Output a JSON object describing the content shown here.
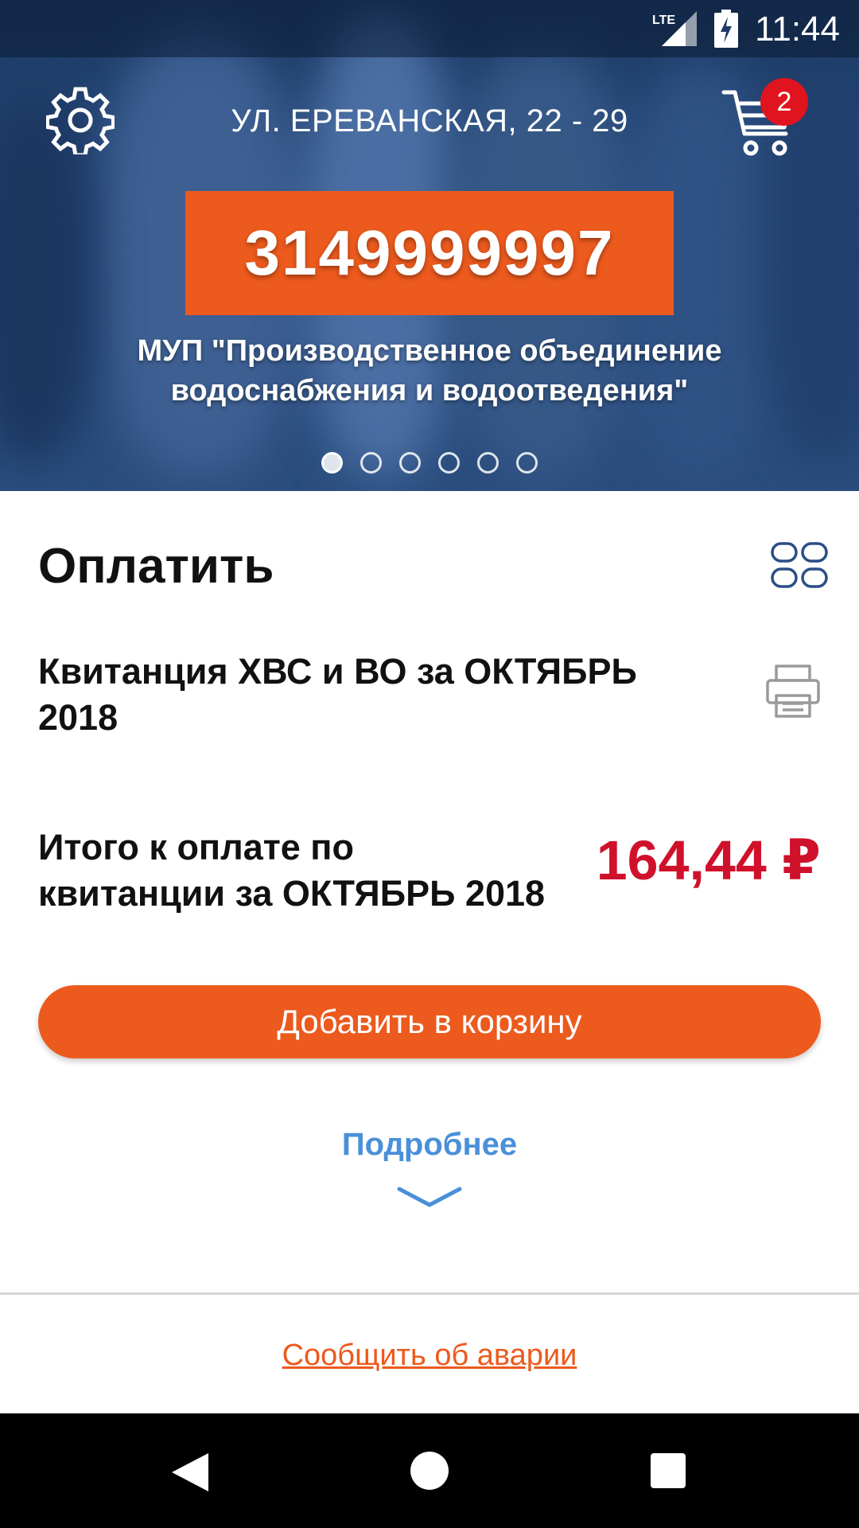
{
  "status_bar": {
    "time": "11:44",
    "network": "LTE"
  },
  "header": {
    "address": "УЛ. ЕРЕВАНСКАЯ, 22 - 29",
    "cart_count": "2",
    "account_number": "3149999997",
    "organization": "МУП \"Производственное объединение водоснабжения и водоотведения\"",
    "carousel": {
      "total": 6,
      "active_index": 0
    }
  },
  "main": {
    "section_title": "Оплатить",
    "receipt_title": "Квитанция ХВС и ВО за ОКТЯБРЬ 2018",
    "total_label": "Итого к оплате по квитанции за ОКТЯБРЬ 2018",
    "total_amount": "164,44 ₽",
    "add_to_cart_label": "Добавить в корзину",
    "more_label": "Подробнее",
    "report_accident_label": "Сообщить об аварии"
  },
  "colors": {
    "accent": "#ec5a1d",
    "amount": "#d0112b",
    "link": "#4a90d9",
    "hero": "#27497a"
  },
  "icons": [
    "settings-icon",
    "cart-icon",
    "grid-icon",
    "print-icon",
    "chevron-down-icon",
    "back-icon",
    "home-icon",
    "recents-icon"
  ]
}
